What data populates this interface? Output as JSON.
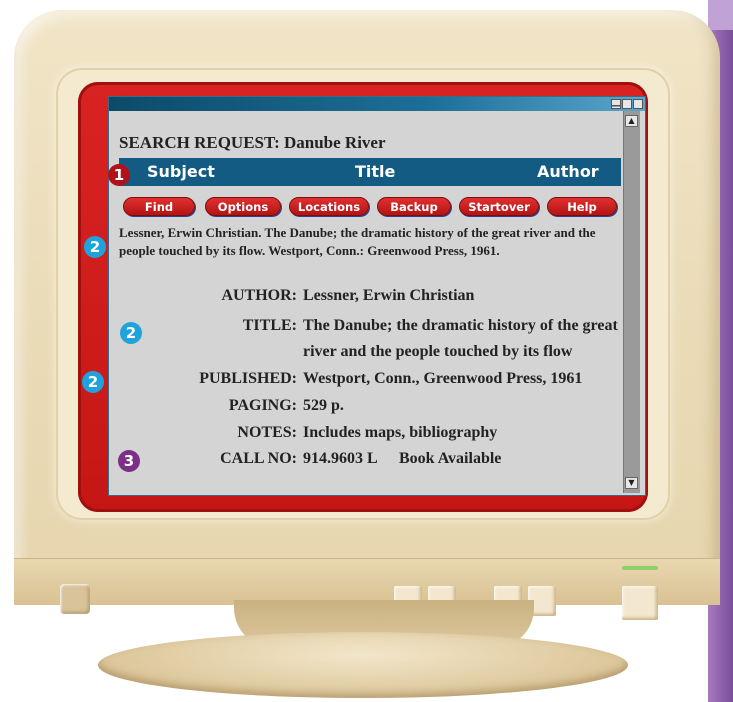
{
  "window": {
    "buttons": [
      "minimize",
      "restore",
      "maximize"
    ]
  },
  "search": {
    "title": "SEARCH REQUEST: Danube River"
  },
  "tabs": [
    {
      "label": "Subject"
    },
    {
      "label": "Title"
    },
    {
      "label": "Author"
    }
  ],
  "buttons": [
    {
      "label": "Find"
    },
    {
      "label": "Options"
    },
    {
      "label": "Locations"
    },
    {
      "label": "Backup"
    },
    {
      "label": "Startover"
    },
    {
      "label": "Help"
    }
  ],
  "citation": {
    "text": "Lessner, Erwin Christian. The Danube; the dramatic history of the great river and the people touched by its flow. Westport, Conn.: Greenwood Press, 1961."
  },
  "record": {
    "author_label": "AUTHOR:",
    "author": "Lessner, Erwin Christian",
    "title_label": "TITLE:",
    "title_line1": "The Danube; the dramatic history of the great",
    "title_line2": "river and the people touched by its flow",
    "published_label": "PUBLISHED:",
    "published": "Westport, Conn., Greenwood Press, 1961",
    "paging_label": "PAGING:",
    "paging": "529 p.",
    "notes_label": "NOTES:",
    "notes": "Includes maps, bibliography",
    "callno_label": "CALL NO:",
    "callno": "914.9603 L",
    "availability": "Book Available"
  },
  "markers": {
    "one": "1",
    "two": "2",
    "three": "3"
  },
  "colors": {
    "frame_red": "#c51616",
    "tab_bar_blue": "#145b83",
    "marker_red": "#b0121b",
    "marker_blue": "#1ea3dc",
    "marker_purple": "#7b2f86",
    "screen_gray": "#d4d4d4"
  },
  "icons": {
    "scroll_up": "▲",
    "scroll_down": "▼"
  }
}
